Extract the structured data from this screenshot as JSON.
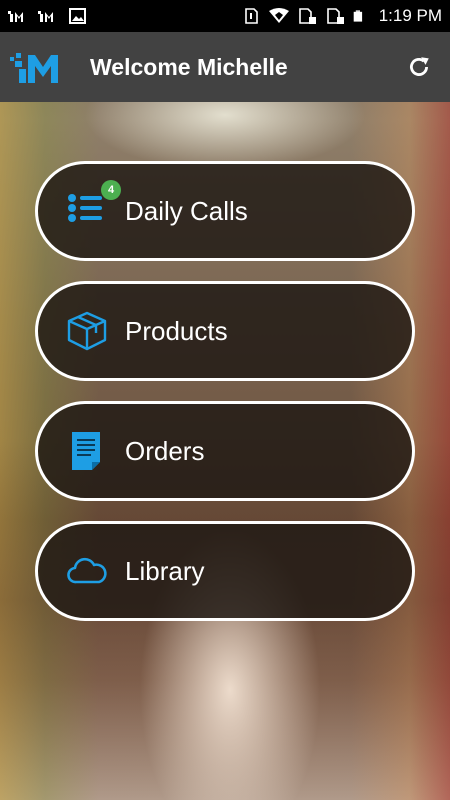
{
  "status_bar": {
    "time": "1:19 PM",
    "left_icons": [
      "app-notification-icon",
      "app-notification-icon",
      "image-icon"
    ],
    "right_icons": [
      "sim-icon",
      "wifi-icon",
      "sim-signal-icon",
      "sim-signal-icon",
      "battery-icon"
    ]
  },
  "app_bar": {
    "title": "Welcome Michelle",
    "logo_icon": "brand-logo-icon",
    "refresh_icon": "refresh-icon"
  },
  "menu": {
    "items": [
      {
        "label": "Daily Calls",
        "icon": "list-icon",
        "badge": "4"
      },
      {
        "label": "Products",
        "icon": "box-icon"
      },
      {
        "label": "Orders",
        "icon": "document-icon"
      },
      {
        "label": "Library",
        "icon": "cloud-icon"
      }
    ]
  },
  "colors": {
    "accent": "#1e9ee4",
    "badge": "#4caf50",
    "app_bar": "#424242",
    "button_bg": "#1e1914"
  }
}
